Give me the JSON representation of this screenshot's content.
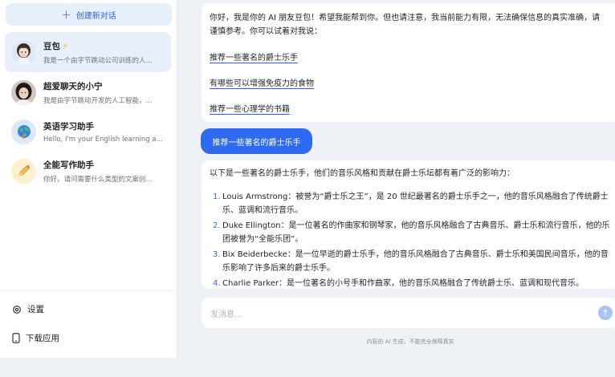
{
  "sidebar": {
    "new_chat_label": "创建新对话",
    "conversations": [
      {
        "title": "豆包",
        "subtitle": "我是一个由字节跳动公司训练的人...",
        "active": true,
        "avatar_icon": "girl-avatar",
        "badge_icon": "lightning-icon"
      },
      {
        "title": "超爱聊天的小宁",
        "subtitle": "我是由字节跳动开发的人工智能，...",
        "active": false,
        "avatar_icon": "photo-avatar"
      },
      {
        "title": "英语学习助手",
        "subtitle": "Hello, I'm your English learning a...",
        "active": false,
        "avatar_icon": "globe-icon"
      },
      {
        "title": "全能写作助手",
        "subtitle": "你好，请问需要什么类型的文案创...",
        "active": false,
        "avatar_icon": "pencil-icon"
      }
    ],
    "settings_label": "设置",
    "download_label": "下载应用"
  },
  "chat": {
    "greeting": "你好，我是你的 AI 朋友豆包！希望我能帮到你。但也请注意，我当前能力有限，无法确保信息的真实准确，请谨慎参考。你可以试着对我说：",
    "suggestions": [
      "推荐一些著名的爵士乐手",
      "有哪些可以增强免疫力的食物",
      "推荐一些心理学的书籍"
    ],
    "user_message": "推荐一些著名的爵士乐手",
    "answer_intro": "以下是一些著名的爵士乐手，他们的音乐风格和贡献在爵士乐坛都有着广泛的影响力：",
    "answer_items": [
      {
        "num": "1.",
        "text": "Louis Armstrong：被誉为“爵士乐之王”，是 20 世纪最著名的爵士乐手之一，他的音乐风格融合了传统爵士乐、蓝调和流行音乐。"
      },
      {
        "num": "2.",
        "text": "Duke Ellington：是一位著名的作曲家和钢琴家，他的音乐风格融合了古典音乐、爵士乐和流行音乐，他的乐团被誉为“全能乐团”。"
      },
      {
        "num": "3.",
        "text": "Bix Beiderbecke：是一位早逝的爵士乐手，他的音乐风格融合了古典音乐、爵士乐和美国民间音乐，他的音乐影响了许多后来的爵士乐手。"
      },
      {
        "num": "4.",
        "text": "Charlie Parker：是一位著名的小号手和作曲家，他的音乐风格融合了传统爵士乐、蓝调和现代音乐。"
      }
    ]
  },
  "input": {
    "placeholder": "发消息...",
    "send_icon": "arrow-up-icon"
  },
  "footer": {
    "disclaimer": "内容由 AI 生成，不能完全保障真实"
  },
  "colors": {
    "accent": "#2e6bf0",
    "active_bg": "#eaf0fb",
    "page_bg": "#eef1f6"
  }
}
